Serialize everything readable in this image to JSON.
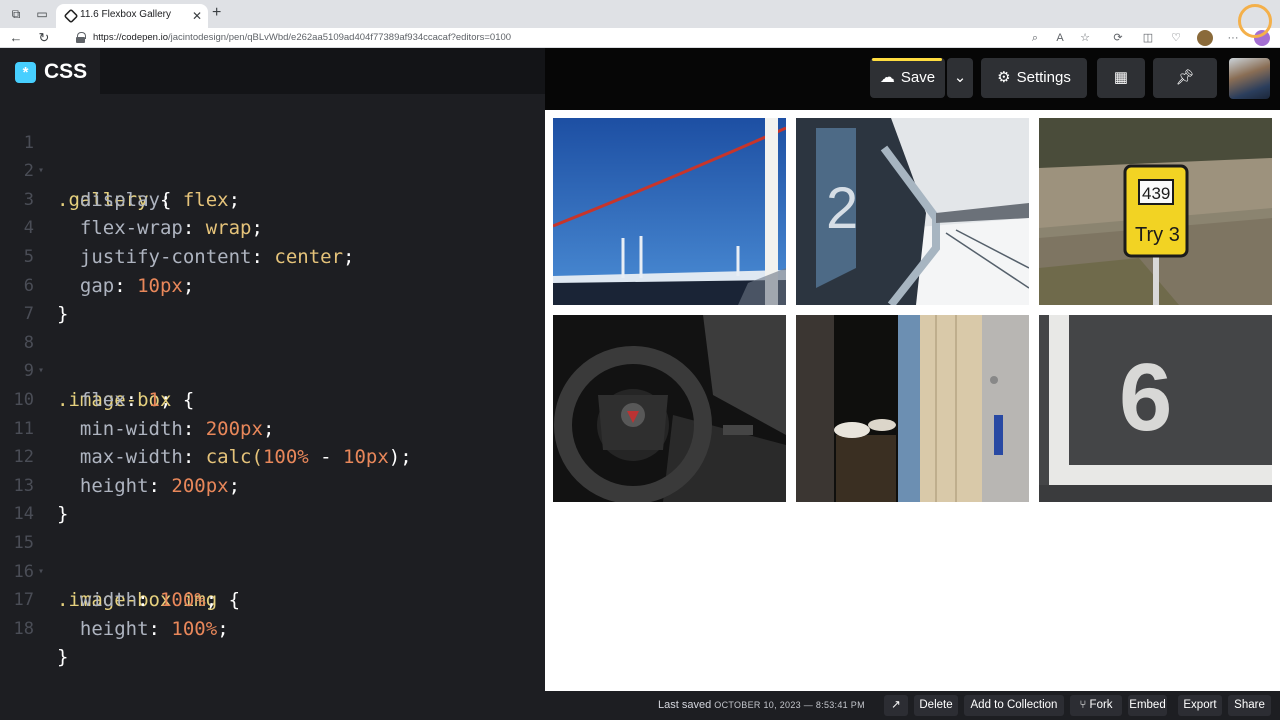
{
  "browser": {
    "tab_title": "11.6 Flexbox Gallery",
    "url_host": "https://codepen.io",
    "url_path": "/jacintodesign/pen/qBLvWbd/e262aa5109ad404f77389af934ccacaf?editors=0100"
  },
  "editor": {
    "title": "CSS",
    "lines": [
      {
        "n": "1",
        "fold": true
      },
      {
        "n": "2"
      },
      {
        "n": "3"
      },
      {
        "n": "4"
      },
      {
        "n": "5"
      },
      {
        "n": "6"
      },
      {
        "n": "7"
      },
      {
        "n": "8",
        "fold": true
      },
      {
        "n": "9"
      },
      {
        "n": "10"
      },
      {
        "n": "11"
      },
      {
        "n": "12"
      },
      {
        "n": "13"
      },
      {
        "n": "14"
      },
      {
        "n": "15",
        "fold": true
      },
      {
        "n": "16"
      },
      {
        "n": "17"
      },
      {
        "n": "18"
      }
    ],
    "code": {
      "l1_sel": ".gallery",
      "l2_prop": "display",
      "l2_val": "flex",
      "l3_prop": "flex-wrap",
      "l3_val": "wrap",
      "l4_prop": "justify-content",
      "l4_val": "center",
      "l5_prop": "gap",
      "l5_val": "10px",
      "l8_sel": ".image-box",
      "l9_prop": "flex",
      "l9_val": "1",
      "l10_prop": "min-width",
      "l10_val": "200px",
      "l11_prop": "max-width",
      "l11_fn": "calc(",
      "l11_a": "100%",
      "l11_op": " - ",
      "l11_b": "10px",
      "l11_end": ");",
      "l12_prop": "height",
      "l12_val": "200px",
      "l15_sel": ".image-box img",
      "l16_prop": "width",
      "l16_val": "100%",
      "l17_prop": "height",
      "l17_val": "100%",
      "open": " {",
      "close": "}",
      "colon": ": ",
      "semi": ";"
    }
  },
  "toolbar": {
    "save_label": "Save",
    "settings_label": "Settings"
  },
  "footer": {
    "last_saved_label": "Last saved",
    "last_saved_value": "OCTOBER 10, 2023 — 8:53:41 PM",
    "delete": "Delete",
    "add_to_collection": "Add to Collection",
    "fork": "Fork",
    "embed": "Embed",
    "export": "Export",
    "share": "Share"
  },
  "colors": {
    "css_badge": "#47cfff",
    "save_accent": "#ffdd40",
    "selector": "#e6d17e",
    "number": "#e8875a"
  }
}
